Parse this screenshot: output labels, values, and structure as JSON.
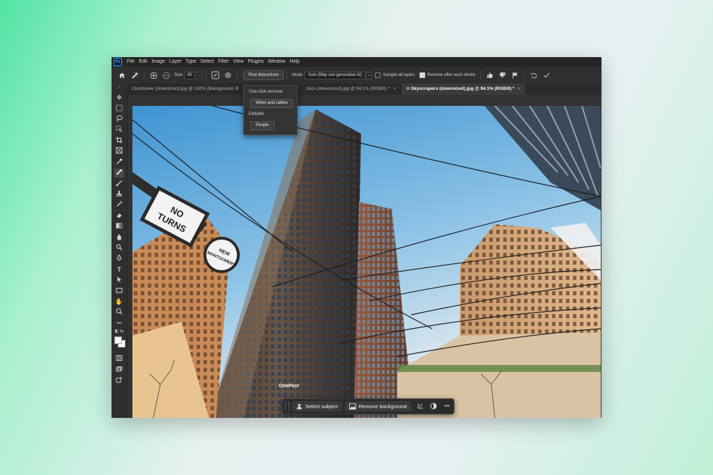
{
  "app": {
    "logo": "Ps"
  },
  "menu": [
    "File",
    "Edit",
    "Image",
    "Layer",
    "Type",
    "Select",
    "Filter",
    "View",
    "Plugins",
    "Window",
    "Help"
  ],
  "options": {
    "size_label": "Size",
    "size_value": "40",
    "find_distractions": "Find distractions",
    "mode_label": "Mode",
    "mode_value": "Auto (May use generative AI)",
    "sample_all_layers": "Sample all layers",
    "remove_after_stroke": "Remove after each stroke"
  },
  "tabs": [
    {
      "label": "Clocktower (downsized).jpg @ 130% (Background, R",
      "close": ""
    },
    {
      "label": "clists (downsized).jpg @ 94.1% (RGB/8) *",
      "close": "×"
    },
    {
      "label": "© Skyscrapers (downsized).jpg @ 94.1% (RGB/8) *",
      "close": "×"
    }
  ],
  "popup": {
    "one_click_label": "One-click removal",
    "wires_button": "Wires and cables",
    "editable_label": "Editable",
    "people_button": "People"
  },
  "contextbar": {
    "select_subject": "Select subject",
    "remove_background": "Remove background",
    "more": "•••"
  },
  "canvas": {
    "sign_no_turns_line1": "NO",
    "sign_no_turns_line2": "TURNS",
    "sign_new_line1": "NEW",
    "sign_new_line2": "MONTGOMERY",
    "building_sign": "OnePost"
  },
  "colors": {
    "accent": "#31a8ff",
    "sky_top": "#4f9fd8",
    "sky_bottom": "#e8eef0"
  }
}
